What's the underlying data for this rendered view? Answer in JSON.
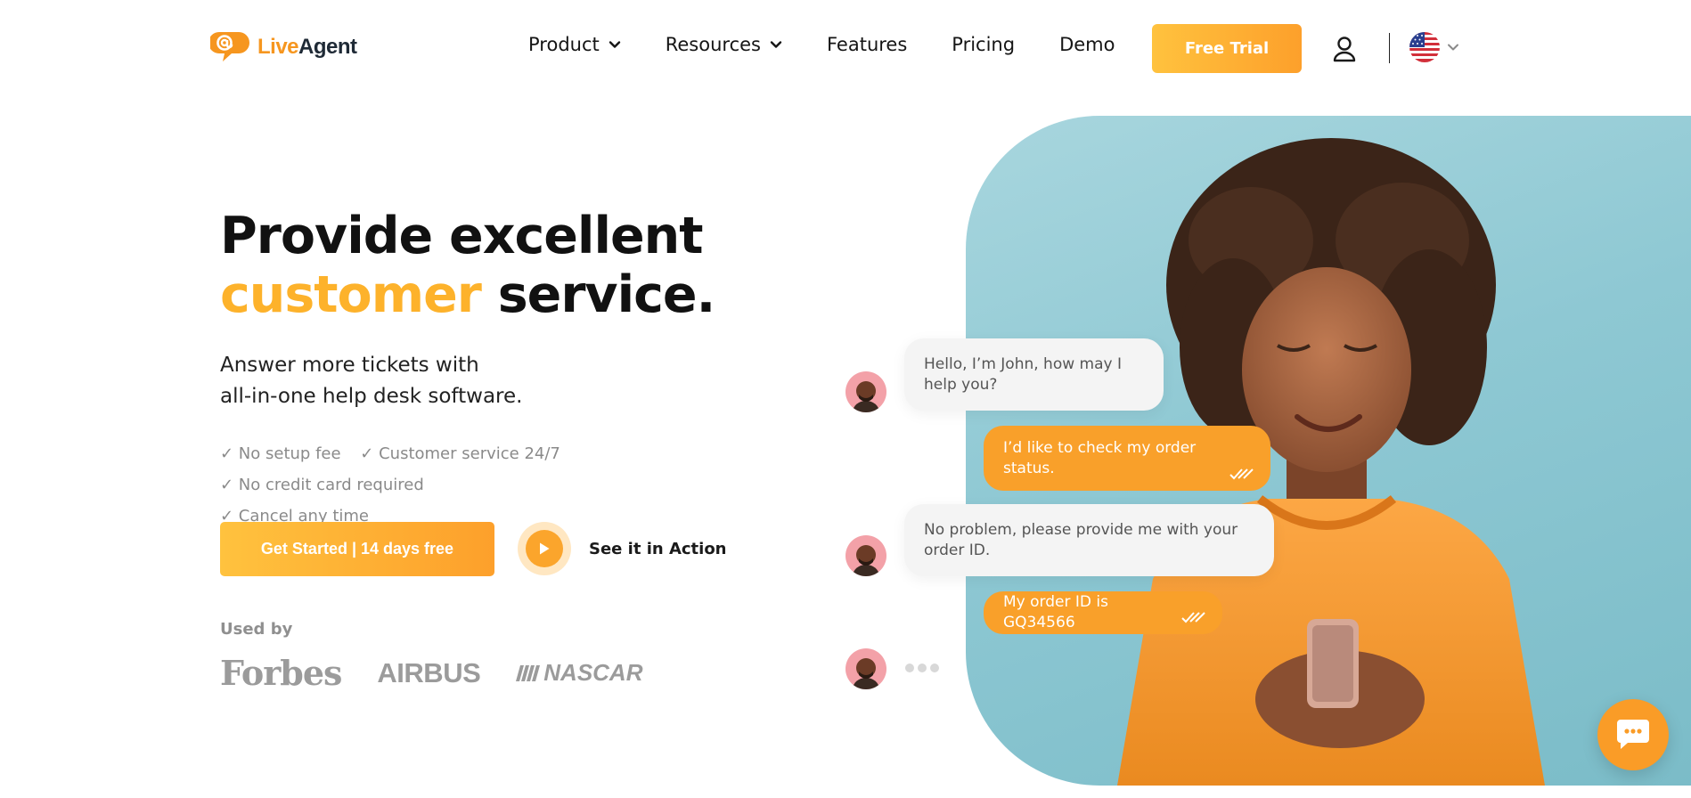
{
  "header": {
    "logo": {
      "live": "Live",
      "agent": "Agent"
    },
    "nav": [
      {
        "label": "Product",
        "has_dropdown": true
      },
      {
        "label": "Resources",
        "has_dropdown": true
      },
      {
        "label": "Features",
        "has_dropdown": false
      },
      {
        "label": "Pricing",
        "has_dropdown": false
      },
      {
        "label": "Demo",
        "has_dropdown": false
      }
    ],
    "cta": "Free Trial",
    "icons": {
      "user": "user-icon",
      "language": "us-flag-icon"
    }
  },
  "hero": {
    "title_line1": "Provide excellent",
    "title_accent": "customer",
    "title_rest": "service.",
    "subtitle_line1": "Answer more tickets with",
    "subtitle_line2": "all-in-one help desk software.",
    "checks": [
      "✓ No setup fee",
      "✓ Customer service 24/7",
      "✓ No credit card required",
      "✓ Cancel any time"
    ],
    "cta_button": "Get Started | 14 days free",
    "play_label": "See it in Action",
    "used_by_label": "Used by",
    "brands": [
      "Forbes",
      "AIRBUS",
      "NASCAR"
    ]
  },
  "chat": {
    "messages": [
      {
        "from": "agent",
        "text": "Hello, I’m John, how may I help you?"
      },
      {
        "from": "user",
        "text": "I’d like to check my order status."
      },
      {
        "from": "agent",
        "text": "No problem, please provide me with your order ID."
      },
      {
        "from": "user",
        "text": "My order ID is GQ34566"
      }
    ]
  },
  "colors": {
    "accent": "#fdb22b",
    "button_gradient_start": "#ffc23e",
    "button_gradient_end": "#fda02b",
    "hero_bg": "#8ec8d3",
    "chat_user_bubble": "#f9a02a"
  }
}
